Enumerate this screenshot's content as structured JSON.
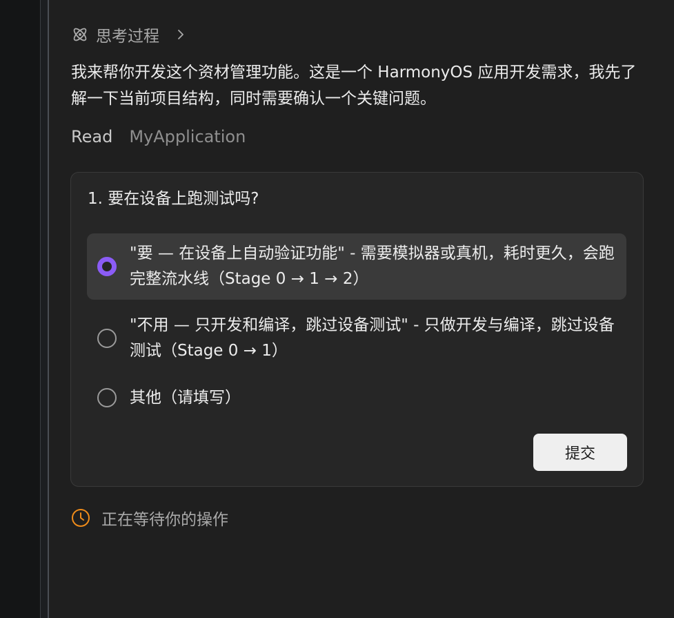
{
  "thinking": {
    "label": "思考过程",
    "icon": "atom-icon",
    "expand_icon": "chevron-right-icon"
  },
  "message": {
    "text": "我来帮你开发这个资材管理功能。这是一个 HarmonyOS 应用开发需求，我先了解一下当前项目结构，同时需要确认一个关键问题。"
  },
  "tool_call": {
    "verb": "Read",
    "target": "MyApplication"
  },
  "question": {
    "title": "1. 要在设备上跑测试吗?",
    "options": [
      {
        "label": "\"要 — 在设备上自动验证功能\" - 需要模拟器或真机，耗时更久，会跑完整流水线（Stage 0 → 1 → 2）",
        "selected": true
      },
      {
        "label": "\"不用 — 只开发和编译，跳过设备测试\" - 只做开发与编译，跳过设备测试（Stage 0 → 1）",
        "selected": false
      },
      {
        "label": "其他（请填写）",
        "selected": false
      }
    ],
    "submit_label": "提交"
  },
  "status": {
    "text": "正在等待你的操作",
    "icon": "clock-icon",
    "icon_color": "#f08c1a"
  },
  "colors": {
    "accent": "#8b5cf6",
    "background": "#1f1f1f",
    "card": "#262626",
    "selected_option": "#3a3a3a",
    "status": "#f08c1a"
  }
}
